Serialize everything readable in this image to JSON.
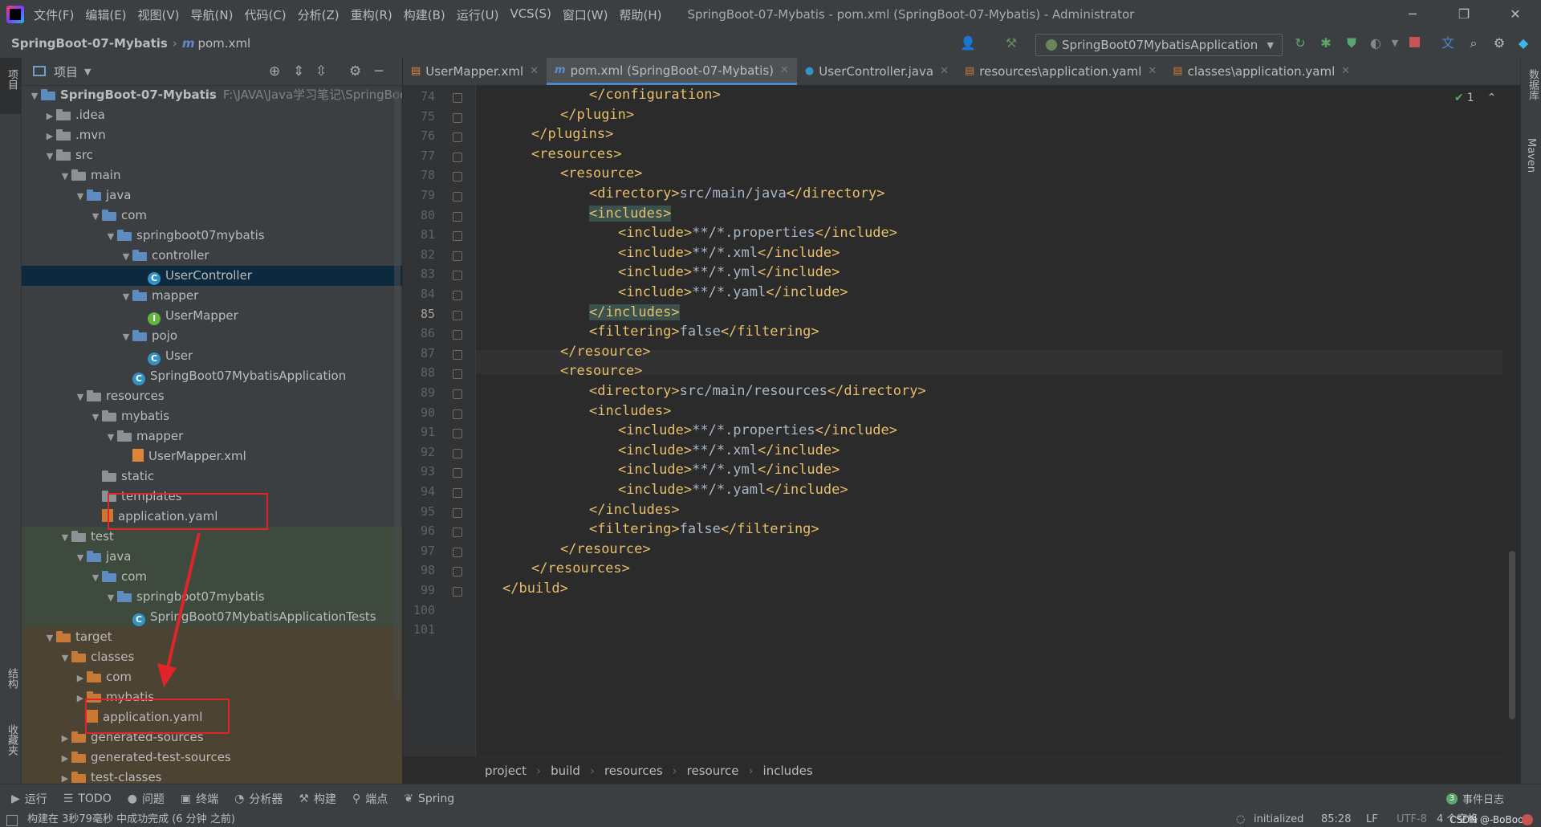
{
  "menubar": {
    "items": [
      "文件(F)",
      "编辑(E)",
      "视图(V)",
      "导航(N)",
      "代码(C)",
      "分析(Z)",
      "重构(R)",
      "构建(B)",
      "运行(U)",
      "VCS(S)",
      "窗口(W)",
      "帮助(H)"
    ],
    "window_title": "SpringBoot-07-Mybatis - pom.xml (SpringBoot-07-Mybatis) - Administrator"
  },
  "navbar": {
    "project": "SpringBoot-07-Mybatis",
    "file": "pom.xml",
    "run_config": "SpringBoot07MybatisApplication"
  },
  "project_panel": {
    "title": "项目",
    "tree": [
      {
        "depth": 0,
        "arrow": "open",
        "icon": "module-folder",
        "label": "SpringBoot-07-Mybatis",
        "bold": true,
        "path": "F:\\JAVA\\Java学习笔记\\SpringBoo"
      },
      {
        "depth": 1,
        "arrow": "closed",
        "icon": "folder",
        "label": ".idea"
      },
      {
        "depth": 1,
        "arrow": "closed",
        "icon": "folder",
        "label": ".mvn"
      },
      {
        "depth": 1,
        "arrow": "open",
        "icon": "folder",
        "label": "src"
      },
      {
        "depth": 2,
        "arrow": "open",
        "icon": "folder",
        "label": "main"
      },
      {
        "depth": 3,
        "arrow": "open",
        "icon": "source-folder",
        "label": "java"
      },
      {
        "depth": 4,
        "arrow": "open",
        "icon": "package",
        "label": "com"
      },
      {
        "depth": 5,
        "arrow": "open",
        "icon": "package",
        "label": "springboot07mybatis"
      },
      {
        "depth": 6,
        "arrow": "open",
        "icon": "package",
        "label": "controller"
      },
      {
        "depth": 7,
        "arrow": "none",
        "icon": "class",
        "label": "UserController",
        "selected": true
      },
      {
        "depth": 6,
        "arrow": "open",
        "icon": "package",
        "label": "mapper"
      },
      {
        "depth": 7,
        "arrow": "none",
        "icon": "interface",
        "label": "UserMapper"
      },
      {
        "depth": 6,
        "arrow": "open",
        "icon": "package",
        "label": "pojo"
      },
      {
        "depth": 7,
        "arrow": "none",
        "icon": "class",
        "label": "User"
      },
      {
        "depth": 6,
        "arrow": "none",
        "icon": "spring-class",
        "label": "SpringBoot07MybatisApplication"
      },
      {
        "depth": 3,
        "arrow": "open",
        "icon": "resource-folder",
        "label": "resources"
      },
      {
        "depth": 4,
        "arrow": "open",
        "icon": "folder",
        "label": "mybatis"
      },
      {
        "depth": 5,
        "arrow": "open",
        "icon": "folder",
        "label": "mapper"
      },
      {
        "depth": 6,
        "arrow": "none",
        "icon": "xml-file",
        "label": "UserMapper.xml"
      },
      {
        "depth": 4,
        "arrow": "none",
        "icon": "folder",
        "label": "static"
      },
      {
        "depth": 4,
        "arrow": "none",
        "icon": "folder",
        "label": "templates"
      },
      {
        "depth": 4,
        "arrow": "none",
        "icon": "yaml-file",
        "label": "application.yaml"
      },
      {
        "depth": 2,
        "arrow": "open",
        "icon": "folder",
        "label": "test",
        "bg": "test"
      },
      {
        "depth": 3,
        "arrow": "open",
        "icon": "test-folder",
        "label": "java",
        "bg": "test"
      },
      {
        "depth": 4,
        "arrow": "open",
        "icon": "package",
        "label": "com",
        "bg": "test"
      },
      {
        "depth": 5,
        "arrow": "open",
        "icon": "package",
        "label": "springboot07mybatis",
        "bg": "test"
      },
      {
        "depth": 6,
        "arrow": "none",
        "icon": "spring-class",
        "label": "SpringBoot07MybatisApplicationTests",
        "bg": "test"
      },
      {
        "depth": 1,
        "arrow": "open",
        "icon": "orange-folder",
        "label": "target",
        "bg": "target"
      },
      {
        "depth": 2,
        "arrow": "open",
        "icon": "orange-folder",
        "label": "classes",
        "bg": "target"
      },
      {
        "depth": 3,
        "arrow": "closed",
        "icon": "orange-folder",
        "label": "com",
        "bg": "target"
      },
      {
        "depth": 3,
        "arrow": "closed",
        "icon": "orange-folder",
        "label": "mybatis",
        "bg": "target"
      },
      {
        "depth": 3,
        "arrow": "none",
        "icon": "yaml-file",
        "label": "application.yaml",
        "bg": "target"
      },
      {
        "depth": 2,
        "arrow": "closed",
        "icon": "orange-folder",
        "label": "generated-sources",
        "bg": "target"
      },
      {
        "depth": 2,
        "arrow": "closed",
        "icon": "orange-folder",
        "label": "generated-test-sources",
        "bg": "target"
      },
      {
        "depth": 2,
        "arrow": "closed",
        "icon": "orange-folder",
        "label": "test-classes",
        "bg": "target"
      }
    ]
  },
  "tabs": [
    {
      "label": "UserMapper.xml",
      "icon": "xml-icon",
      "active": false
    },
    {
      "label": "pom.xml (SpringBoot-07-Mybatis)",
      "icon": "maven-icon",
      "active": true
    },
    {
      "label": "UserController.java",
      "icon": "class-icon",
      "active": false
    },
    {
      "label": "resources\\application.yaml",
      "icon": "yaml-icon",
      "active": false
    },
    {
      "label": "classes\\application.yaml",
      "icon": "yaml-icon",
      "active": false
    }
  ],
  "editor": {
    "inspection_count": "1",
    "current_line": 85,
    "lines": [
      {
        "n": 74,
        "indent": 3,
        "parts": [
          [
            "br",
            "</"
          ],
          [
            "tg",
            "configuration"
          ],
          [
            "br",
            ">"
          ]
        ]
      },
      {
        "n": 75,
        "indent": 2,
        "parts": [
          [
            "br",
            "</"
          ],
          [
            "tg",
            "plugin"
          ],
          [
            "br",
            ">"
          ]
        ]
      },
      {
        "n": 76,
        "indent": 1,
        "parts": [
          [
            "br",
            "</"
          ],
          [
            "tg",
            "plugins"
          ],
          [
            "br",
            ">"
          ]
        ]
      },
      {
        "n": 77,
        "indent": 1,
        "parts": [
          [
            "br",
            "<"
          ],
          [
            "tg",
            "resources"
          ],
          [
            "br",
            ">"
          ]
        ]
      },
      {
        "n": 78,
        "indent": 2,
        "parts": [
          [
            "br",
            "<"
          ],
          [
            "tg",
            "resource"
          ],
          [
            "br",
            ">"
          ]
        ]
      },
      {
        "n": 79,
        "indent": 3,
        "parts": [
          [
            "br",
            "<"
          ],
          [
            "tg",
            "directory"
          ],
          [
            "br",
            ">"
          ],
          [
            "tx",
            "src/main/java"
          ],
          [
            "br",
            "</"
          ],
          [
            "tg",
            "directory"
          ],
          [
            "br",
            ">"
          ]
        ]
      },
      {
        "n": 80,
        "indent": 3,
        "parts": [
          [
            "hl",
            "<includes>"
          ],
          [
            "br",
            ""
          ]
        ]
      },
      {
        "n": 81,
        "indent": 4,
        "parts": [
          [
            "tg",
            "<include>"
          ],
          [
            "tx",
            "**/*.properties"
          ],
          [
            "tg",
            "</include>"
          ]
        ]
      },
      {
        "n": 82,
        "indent": 4,
        "parts": [
          [
            "tg",
            "<include>"
          ],
          [
            "tx",
            "**/*.xml"
          ],
          [
            "tg",
            "</include>"
          ]
        ]
      },
      {
        "n": 83,
        "indent": 4,
        "parts": [
          [
            "tg",
            "<include>"
          ],
          [
            "tx",
            "**/*.yml"
          ],
          [
            "tg",
            "</include>"
          ]
        ]
      },
      {
        "n": 84,
        "indent": 4,
        "parts": [
          [
            "tg",
            "<include>"
          ],
          [
            "tx",
            "**/*.yaml"
          ],
          [
            "tg",
            "</include>"
          ]
        ]
      },
      {
        "n": 85,
        "indent": 3,
        "parts": [
          [
            "hl",
            "</includes>"
          ]
        ]
      },
      {
        "n": 86,
        "indent": 3,
        "parts": [
          [
            "br",
            "<"
          ],
          [
            "tg",
            "filtering"
          ],
          [
            "br",
            ">"
          ],
          [
            "tx",
            "false"
          ],
          [
            "br",
            "</"
          ],
          [
            "tg",
            "filtering"
          ],
          [
            "br",
            ">"
          ]
        ]
      },
      {
        "n": 87,
        "indent": 2,
        "parts": [
          [
            "br",
            "</"
          ],
          [
            "tg",
            "resource"
          ],
          [
            "br",
            ">"
          ]
        ]
      },
      {
        "n": 88,
        "indent": 2,
        "parts": [
          [
            "br",
            "<"
          ],
          [
            "tg",
            "resource"
          ],
          [
            "br",
            ">"
          ]
        ]
      },
      {
        "n": 89,
        "indent": 3,
        "parts": [
          [
            "br",
            "<"
          ],
          [
            "tg",
            "directory"
          ],
          [
            "br",
            ">"
          ],
          [
            "tx",
            "src/main/resources"
          ],
          [
            "br",
            "</"
          ],
          [
            "tg",
            "directory"
          ],
          [
            "br",
            ">"
          ]
        ]
      },
      {
        "n": 90,
        "indent": 3,
        "parts": [
          [
            "br",
            "<"
          ],
          [
            "tg",
            "includes"
          ],
          [
            "br",
            ">"
          ]
        ]
      },
      {
        "n": 91,
        "indent": 4,
        "parts": [
          [
            "tg",
            "<include>"
          ],
          [
            "tx",
            "**/*.properties"
          ],
          [
            "tg",
            "</include>"
          ]
        ]
      },
      {
        "n": 92,
        "indent": 4,
        "parts": [
          [
            "tg",
            "<include>"
          ],
          [
            "tx",
            "**/*.xml"
          ],
          [
            "tg",
            "</include>"
          ]
        ]
      },
      {
        "n": 93,
        "indent": 4,
        "parts": [
          [
            "tg",
            "<include>"
          ],
          [
            "tx",
            "**/*.yml"
          ],
          [
            "tg",
            "</include>"
          ]
        ]
      },
      {
        "n": 94,
        "indent": 4,
        "parts": [
          [
            "tg",
            "<include>"
          ],
          [
            "tx",
            "**/*.yaml"
          ],
          [
            "tg",
            "</include>"
          ]
        ]
      },
      {
        "n": 95,
        "indent": 3,
        "parts": [
          [
            "br",
            "</"
          ],
          [
            "tg",
            "includes"
          ],
          [
            "br",
            ">"
          ]
        ]
      },
      {
        "n": 96,
        "indent": 3,
        "parts": [
          [
            "br",
            "<"
          ],
          [
            "tg",
            "filtering"
          ],
          [
            "br",
            ">"
          ],
          [
            "tx",
            "false"
          ],
          [
            "br",
            "</"
          ],
          [
            "tg",
            "filtering"
          ],
          [
            "br",
            ">"
          ]
        ]
      },
      {
        "n": 97,
        "indent": 2,
        "parts": [
          [
            "br",
            "</"
          ],
          [
            "tg",
            "resource"
          ],
          [
            "br",
            ">"
          ]
        ]
      },
      {
        "n": 98,
        "indent": 1,
        "parts": [
          [
            "br",
            "</"
          ],
          [
            "tg",
            "resources"
          ],
          [
            "br",
            ">"
          ]
        ]
      },
      {
        "n": 99,
        "indent": 0,
        "parts": [
          [
            "br",
            "</"
          ],
          [
            "tg",
            "build"
          ],
          [
            "br",
            ">"
          ]
        ]
      },
      {
        "n": 100,
        "indent": 0,
        "parts": []
      },
      {
        "n": 101,
        "indent": 0,
        "parts": []
      }
    ]
  },
  "breadcrumb": [
    "project",
    "build",
    "resources",
    "resource",
    "includes"
  ],
  "bottom_tools": [
    {
      "icon": "run-icon",
      "glyph": "▶",
      "label": "运行"
    },
    {
      "icon": "todo-icon",
      "glyph": "☰",
      "label": "TODO"
    },
    {
      "icon": "problems-icon",
      "glyph": "●",
      "label": "问题"
    },
    {
      "icon": "terminal-icon",
      "glyph": "▣",
      "label": "终端"
    },
    {
      "icon": "profiler-icon",
      "glyph": "◔",
      "label": "分析器"
    },
    {
      "icon": "build-icon",
      "glyph": "⚒",
      "label": "构建"
    },
    {
      "icon": "endpoints-icon",
      "glyph": "⚲",
      "label": "端点"
    },
    {
      "icon": "spring-icon",
      "glyph": "❦",
      "label": "Spring"
    }
  ],
  "event_log": {
    "count": "3",
    "label": "事件日志"
  },
  "status": {
    "message": "构建在 3秒79毫秒 中成功完成 (6 分钟 之前)",
    "vcs": "initialized",
    "position": "85:28",
    "line_sep": "LF",
    "encoding": "UTF-8",
    "indent": "4 个空格",
    "watermark": "CSDN @-BoBooY"
  },
  "side_labels": {
    "left_top": "项目",
    "left_mid": "结构",
    "left_bot": "收藏夹",
    "right_top": "数据库",
    "right_mid": "Maven"
  },
  "colors": {
    "accent": "#4a88c7",
    "annotation": "#e0252a",
    "selection": "#0d293e"
  }
}
